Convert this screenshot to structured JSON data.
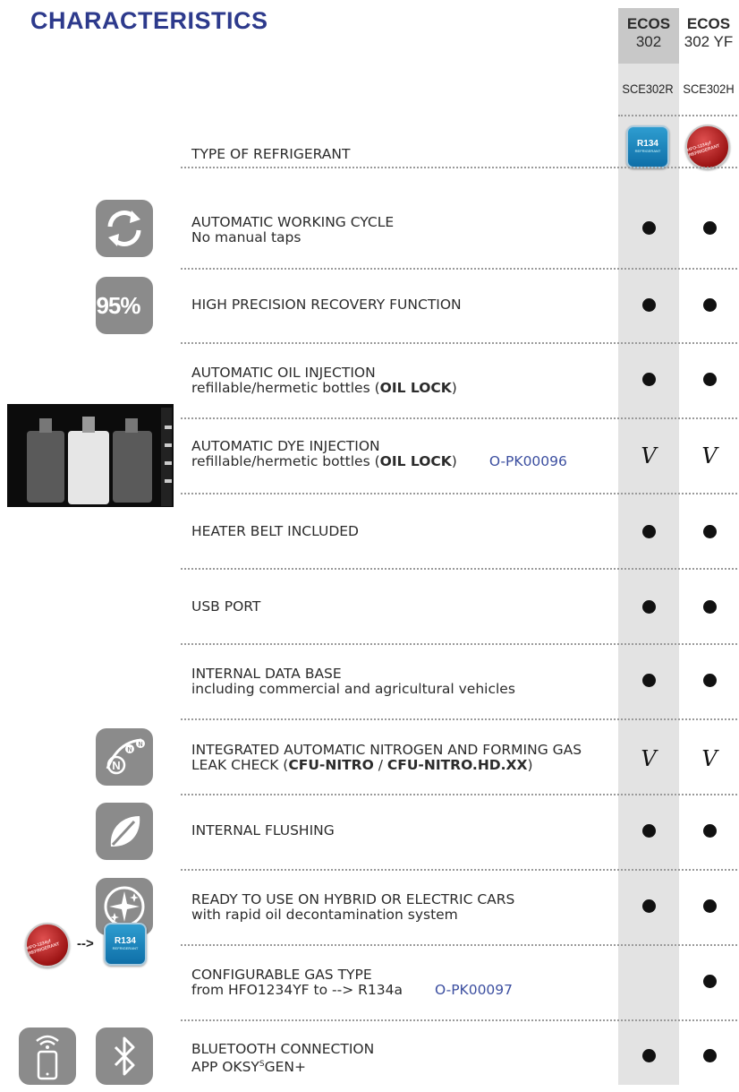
{
  "header": {
    "title": "CHARACTERISTICS",
    "title_color": "#2d3a8c",
    "columns": [
      {
        "name": "ECOS",
        "version": "302",
        "code": "SCE302R"
      },
      {
        "name": "ECOS",
        "version": "302 YF",
        "code": "SCE302H"
      }
    ]
  },
  "refrigerant_badges": {
    "r134_top": "R134",
    "r134_sub": "REFRIGERANT",
    "hfo_text": "HFO-1234yf REFRIGERANT"
  },
  "rows": [
    {
      "icon": "refrigerant-badges",
      "line1": "TYPE OF REFRIGERANT",
      "line2": ""
    },
    {
      "icon": "cycle-arrows-icon",
      "line1": "AUTOMATIC WORKING CYCLE",
      "line2": "No manual taps",
      "col1": "dot",
      "col2": "dot"
    },
    {
      "icon": "percent-95-icon",
      "icon_text": "95%",
      "line1": "HIGH PRECISION RECOVERY FUNCTION",
      "line2": "",
      "col1": "dot",
      "col2": "dot"
    },
    {
      "line1": "AUTOMATIC OIL INJECTION",
      "line2_pre": "refillable/hermetic bottles (",
      "line2_bold": "OIL LOCK",
      "line2_post": ")",
      "col1": "dot",
      "col2": "dot"
    },
    {
      "icon": "bottles-photo",
      "line1": "AUTOMATIC DYE INJECTION",
      "line2_pre": "refillable/hermetic bottles (",
      "line2_bold": "OIL LOCK",
      "line2_post": ")",
      "ref": "O-PK00096",
      "col1": "V",
      "col2": "V"
    },
    {
      "line1": "HEATER BELT INCLUDED",
      "line2": "",
      "col1": "dot",
      "col2": "dot"
    },
    {
      "line1": "USB PORT",
      "line2": "",
      "col1": "dot",
      "col2": "dot"
    },
    {
      "line1": "INTERNAL DATA BASE",
      "line2": "including commercial and agricultural vehicles",
      "col1": "dot",
      "col2": "dot"
    },
    {
      "icon": "nitrogen-icon",
      "line1": "INTEGRATED AUTOMATIC NITROGEN AND FORMING GAS",
      "line2_pre": "LEAK CHECK (",
      "line2_bold": "CFU-NITRO",
      "line2_mid": " / ",
      "line2_bold2": "CFU-NITRO.HD.XX",
      "line2_post": ")",
      "col1": "V",
      "col2": "V"
    },
    {
      "icon": "leaf-icon",
      "line1": "INTERNAL FLUSHING",
      "line2": "",
      "col1": "dot",
      "col2": "dot"
    },
    {
      "icon": "electric-sparkle-icon",
      "line1": "READY TO USE ON HYBRID OR ELECTRIC CARS",
      "line2": "with rapid oil decontamination system",
      "col1": "dot",
      "col2": "dot"
    },
    {
      "icon": "gas-conversion-icons",
      "arrow": "-->",
      "line1": "CONFIGURABLE GAS TYPE",
      "line2": "from HFO1234YF to --> R134a",
      "ref": "O-PK00097",
      "col1": "",
      "col2": "dot"
    },
    {
      "icon": "phone-bluetooth-icons",
      "line1": "BLUETOOTH CONNECTION",
      "line2_pre": "APP OKSY",
      "line2_sup": "S",
      "line2_post": "GEN+",
      "col1": "dot",
      "col2": "dot"
    }
  ]
}
